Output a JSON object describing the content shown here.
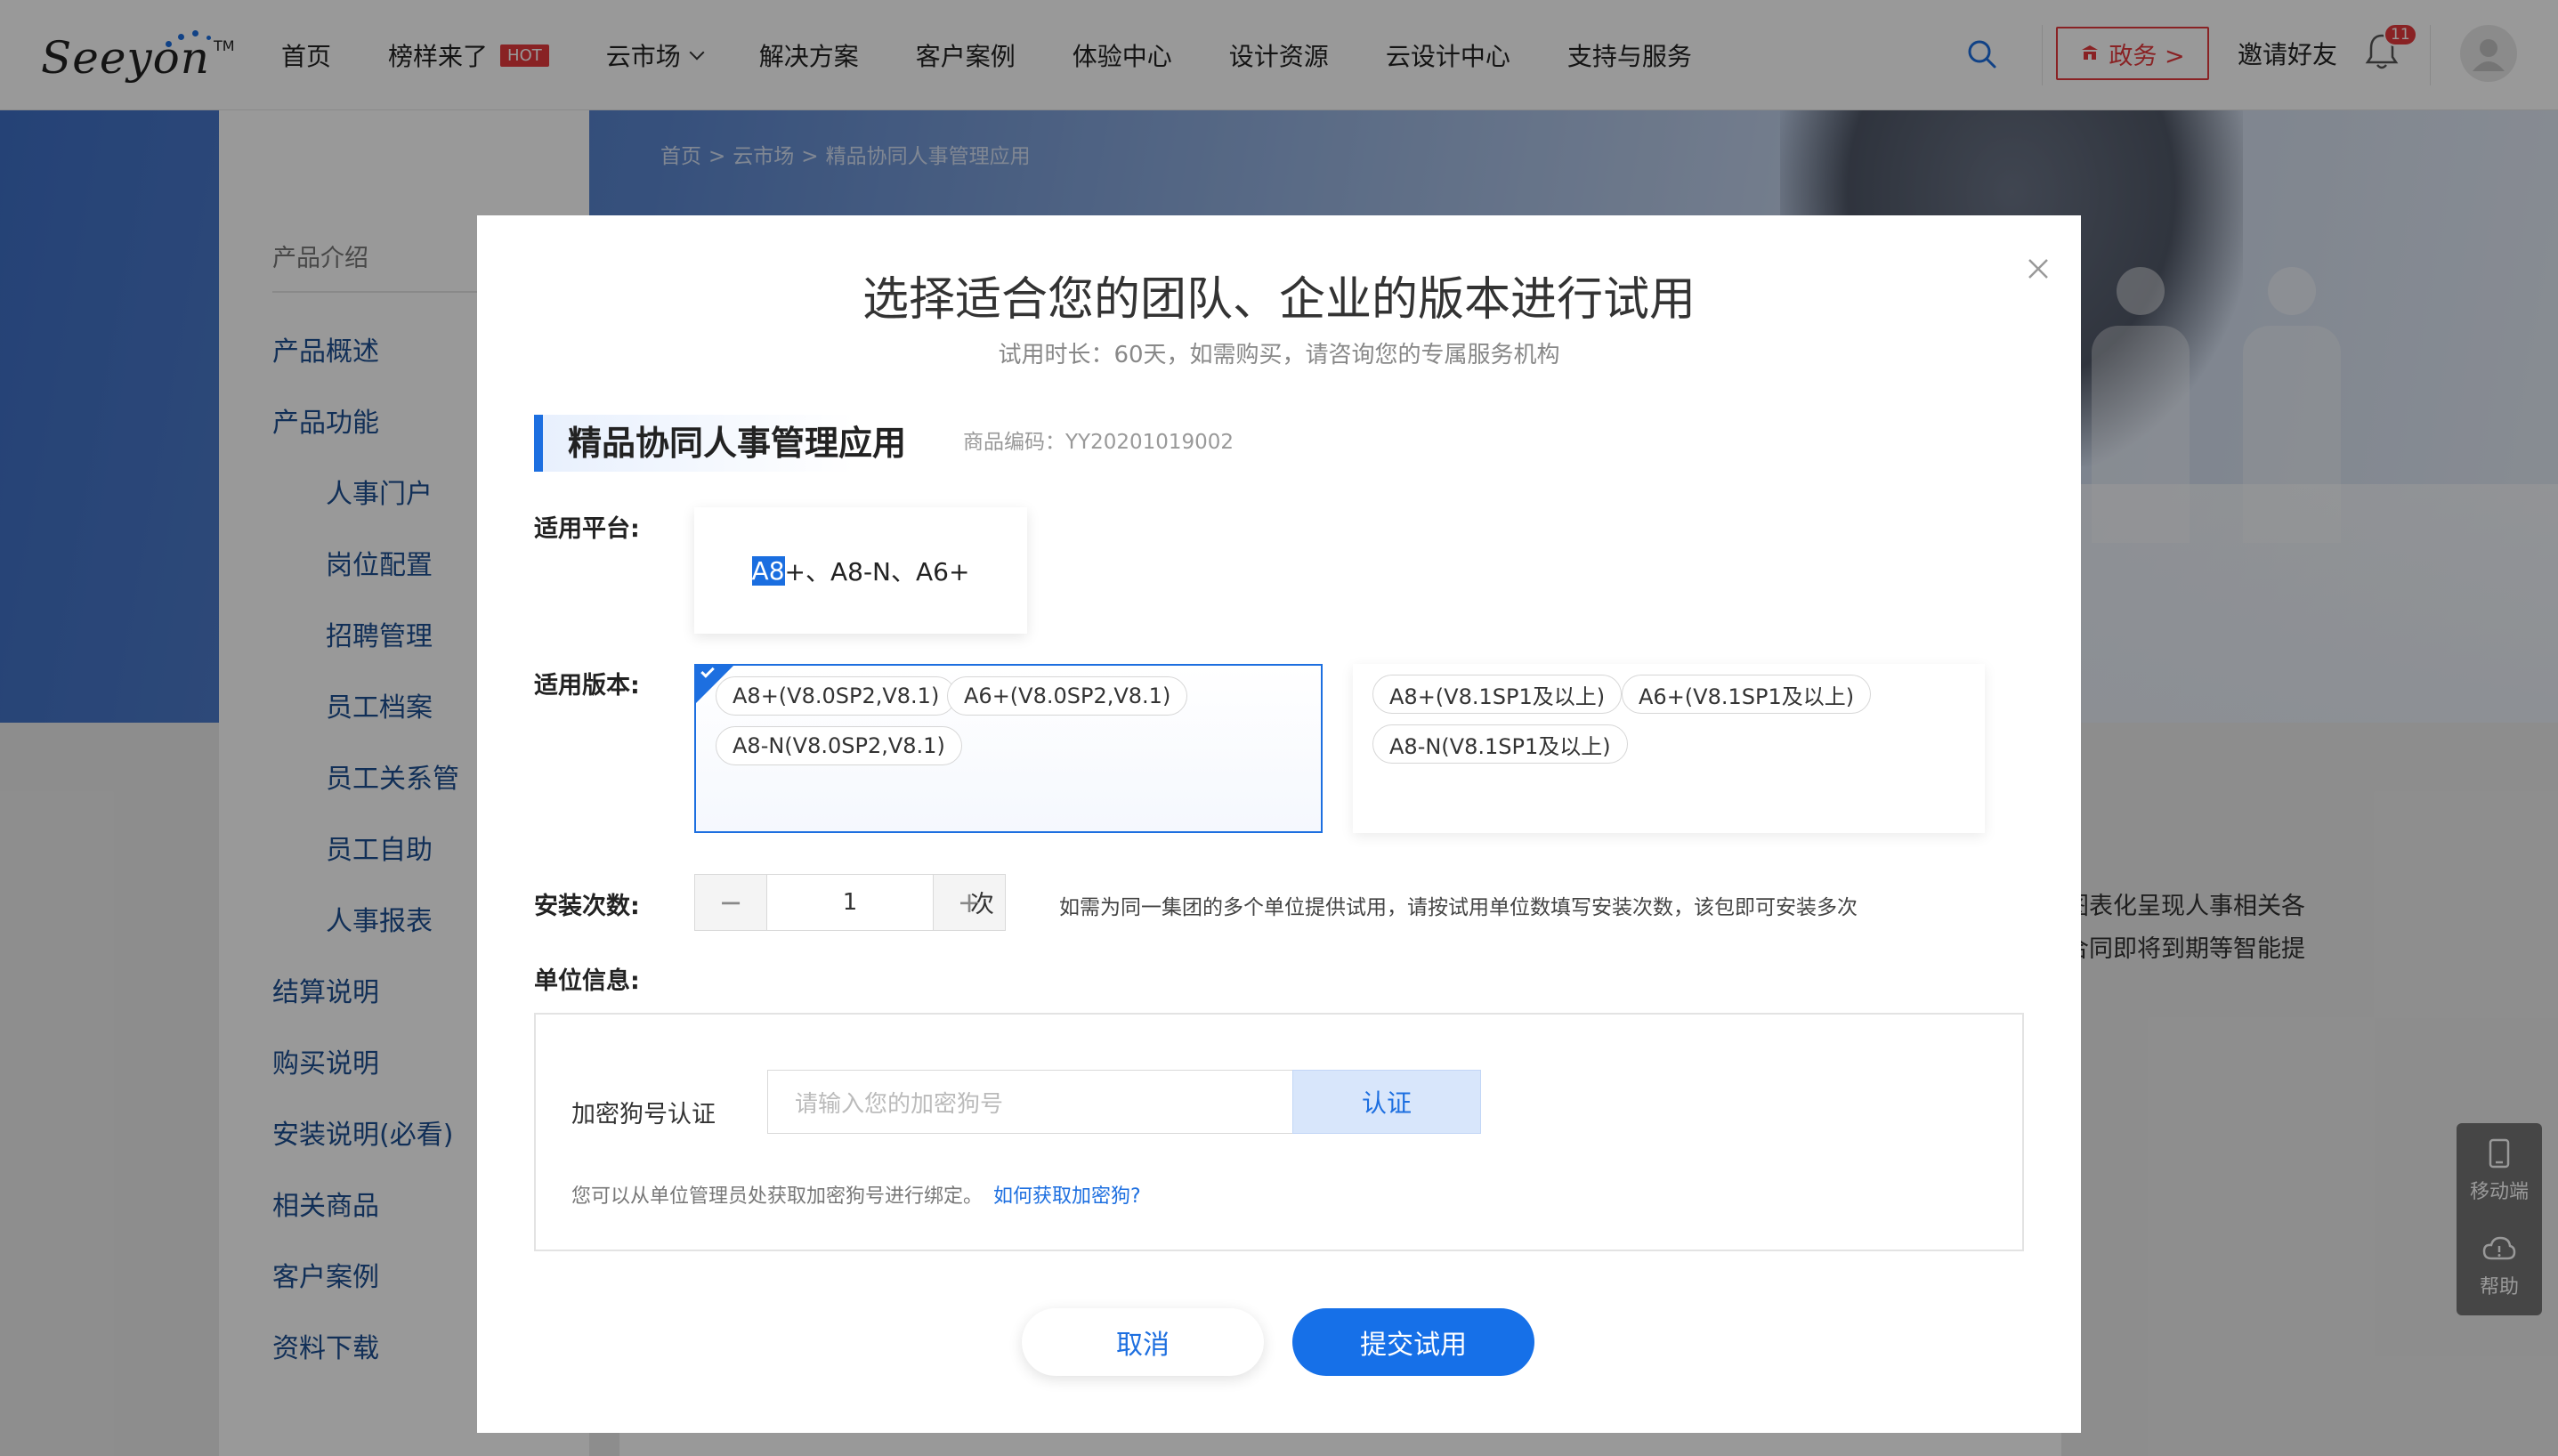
{
  "header": {
    "logo_text": "Seeyon",
    "logo_tm": "TM",
    "nav": [
      {
        "label": "首页"
      },
      {
        "label": "榜样来了",
        "badge": "HOT"
      },
      {
        "label": "云市场"
      },
      {
        "label": "解决方案"
      },
      {
        "label": "客户案例"
      },
      {
        "label": "体验中心"
      },
      {
        "label": "设计资源"
      },
      {
        "label": "云设计中心"
      },
      {
        "label": "支持与服务"
      }
    ],
    "gov_label": "政务 >",
    "invite_label": "邀请好友",
    "notification_count": "11"
  },
  "breadcrumb": [
    "首页",
    ">",
    "云市场",
    ">",
    "精品协同人事管理应用"
  ],
  "sidebar": {
    "title": "产品介绍",
    "items": [
      {
        "label": "产品概述",
        "level": 1
      },
      {
        "label": "产品功能",
        "level": 1
      },
      {
        "label": "人事门户",
        "level": 2
      },
      {
        "label": "岗位配置",
        "level": 2
      },
      {
        "label": "招聘管理",
        "level": 2
      },
      {
        "label": "员工档案",
        "level": 2
      },
      {
        "label": "员工关系管",
        "level": 2
      },
      {
        "label": "员工自助",
        "level": 2
      },
      {
        "label": "人事报表",
        "level": 2
      },
      {
        "label": "结算说明",
        "level": 1
      },
      {
        "label": "购买说明",
        "level": 1
      },
      {
        "label": "安装说明(必看)",
        "level": 1
      },
      {
        "label": "相关商品",
        "level": 1
      },
      {
        "label": "客户案例",
        "level": 1
      },
      {
        "label": "资料下载",
        "level": 1
      }
    ]
  },
  "background_text": [
    "图表化呈现人事相关各",
    "合同即将到期等智能提"
  ],
  "float_bar": {
    "mobile_label": "移动端",
    "help_label": "帮助"
  },
  "modal": {
    "title": "选择适合您的团队、企业的版本进行试用",
    "subtitle": "试用时长：60天，如需购买，请咨询您的专属服务机构",
    "product_name": "精品协同人事管理应用",
    "product_code": "商品编码：YY20201019002",
    "platform_label": "适用平台:",
    "platform_selected_part": "A8",
    "platform_rest": "+、A8-N、A6+",
    "version_label": "适用版本:",
    "version_groups": [
      {
        "selected": true,
        "tags": [
          "A8+(V8.0SP2,V8.1)",
          "A6+(V8.0SP2,V8.1)",
          "A8-N(V8.0SP2,V8.1)"
        ]
      },
      {
        "selected": false,
        "tags": [
          "A8+(V8.1SP1及以上)",
          "A6+(V8.1SP1及以上)",
          "A8-N(V8.1SP1及以上)"
        ]
      }
    ],
    "install_label": "安装次数:",
    "install_minus": "−",
    "install_count": "1",
    "install_plus": "+",
    "install_unit": "次",
    "install_hint": "如需为同一集团的多个单位提供试用，请按试用单位数填写安装次数，该包即可安装多次",
    "unit_label": "单位信息:",
    "dongle_label": "加密狗号认证",
    "dongle_placeholder": "请输入您的加密狗号",
    "verify_label": "认证",
    "dongle_hint": "您可以从单位管理员处获取加密狗号进行绑定。",
    "dongle_link": "如何获取加密狗?",
    "cancel_label": "取消",
    "submit_label": "提交试用"
  },
  "colors": {
    "accent": "#1d6fe0",
    "hot": "#e4393c",
    "submit": "#1670e8"
  }
}
